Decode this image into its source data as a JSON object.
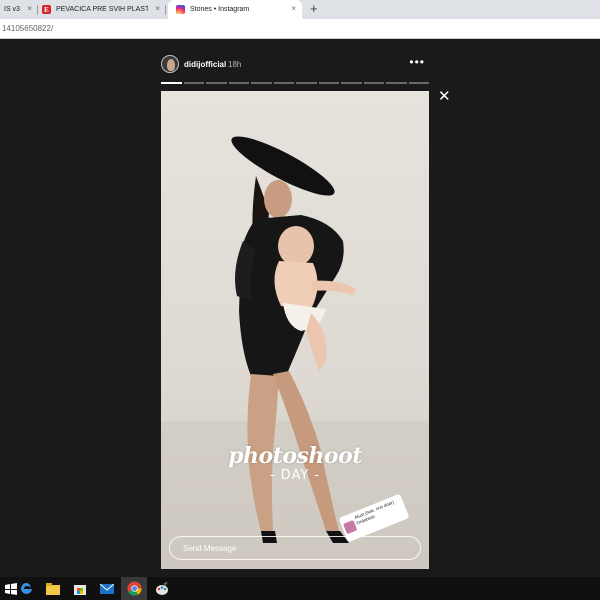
{
  "tabs": [
    {
      "label": "IS v3",
      "favicon": "blank"
    },
    {
      "label": "PEVAČICA PRE SVIH PLASTIČNIH",
      "favicon": "e-logo"
    },
    {
      "label": "Stories • Instagram",
      "favicon": "instagram-logo"
    }
  ],
  "tab_close_glyph": "×",
  "new_tab_glyph": "+",
  "address": {
    "url": "14105650822/"
  },
  "story": {
    "username": "didijofficial",
    "time": "18h",
    "more_glyph": "•••",
    "close_glyph": "✕",
    "progress": {
      "segments": 12,
      "completed": 1
    },
    "caption_line1": "photoshoot",
    "caption_line2": "- DAY -",
    "mention_text": "Atust (hoe, nnn doer) Ordobicle",
    "reply_placeholder": "Send Message"
  },
  "taskbar": {
    "icons": [
      "windows-start-icon",
      "edge-icon",
      "file-explorer-icon",
      "store-icon",
      "mail-icon",
      "chrome-icon",
      "paint-icon"
    ],
    "active": "chrome-icon"
  }
}
